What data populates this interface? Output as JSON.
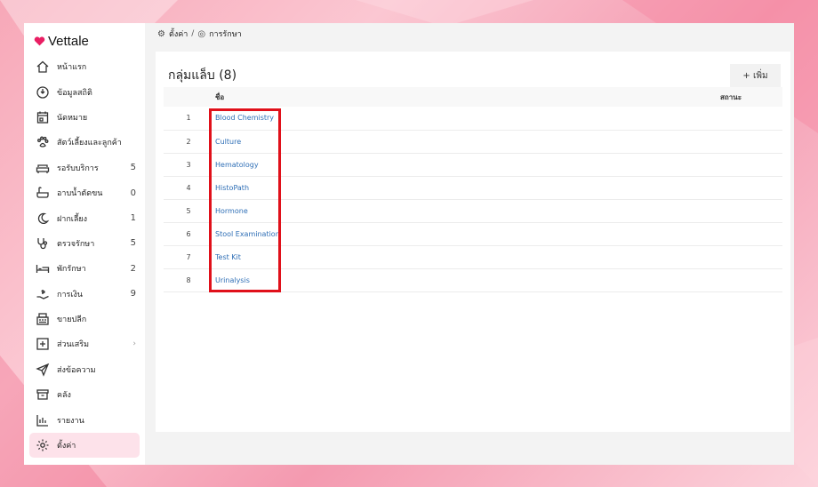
{
  "app": {
    "name": "Vettale"
  },
  "breadcrumb": {
    "root": "ตั้งค่า",
    "separator": "/",
    "current": "การรักษา"
  },
  "sidebar": {
    "items": [
      {
        "label": "หน้าแรก",
        "icon": "home-icon",
        "count": ""
      },
      {
        "label": "ข้อมูลสถิติ",
        "icon": "stats-icon",
        "count": ""
      },
      {
        "label": "นัดหมาย",
        "icon": "calendar-icon",
        "count": ""
      },
      {
        "label": "สัตว์เลี้ยงและลูกค้า",
        "icon": "paw-icon",
        "count": ""
      },
      {
        "label": "รอรับบริการ",
        "icon": "sofa-icon",
        "count": "5"
      },
      {
        "label": "อาบน้ำตัดขน",
        "icon": "bath-icon",
        "count": "0"
      },
      {
        "label": "ฝากเลี้ยง",
        "icon": "moon-icon",
        "count": "1"
      },
      {
        "label": "ตรวจรักษา",
        "icon": "stethoscope-icon",
        "count": "5"
      },
      {
        "label": "พักรักษา",
        "icon": "bed-icon",
        "count": "2"
      },
      {
        "label": "การเงิน",
        "icon": "money-hand-icon",
        "count": "9"
      },
      {
        "label": "ขายปลีก",
        "icon": "register-icon",
        "count": ""
      },
      {
        "label": "ส่วนเสริม",
        "icon": "plus-box-icon",
        "count": "›"
      },
      {
        "label": "ส่งข้อความ",
        "icon": "send-icon",
        "count": ""
      },
      {
        "label": "คลัง",
        "icon": "archive-icon",
        "count": ""
      },
      {
        "label": "รายงาน",
        "icon": "report-icon",
        "count": ""
      },
      {
        "label": "ตั้งค่า",
        "icon": "gear-icon",
        "count": ""
      }
    ]
  },
  "panel": {
    "title": "กลุ่มแล็บ (8)",
    "add_label": "+ เพิ่ม",
    "columns": {
      "index": "",
      "name": "ชื่อ",
      "status": "สถานะ"
    },
    "rows": [
      {
        "index": "1",
        "name": "Blood Chemistry"
      },
      {
        "index": "2",
        "name": "Culture"
      },
      {
        "index": "3",
        "name": "Hematology"
      },
      {
        "index": "4",
        "name": "HistoPath"
      },
      {
        "index": "5",
        "name": "Hormone"
      },
      {
        "index": "6",
        "name": "Stool Examination"
      },
      {
        "index": "7",
        "name": "Test Kit"
      },
      {
        "index": "8",
        "name": "Urinalysis"
      }
    ]
  },
  "colors": {
    "accent": "#e91e63",
    "highlight": "#e0101a",
    "link": "#2f6fb6",
    "active_bg": "#fde2ea"
  }
}
